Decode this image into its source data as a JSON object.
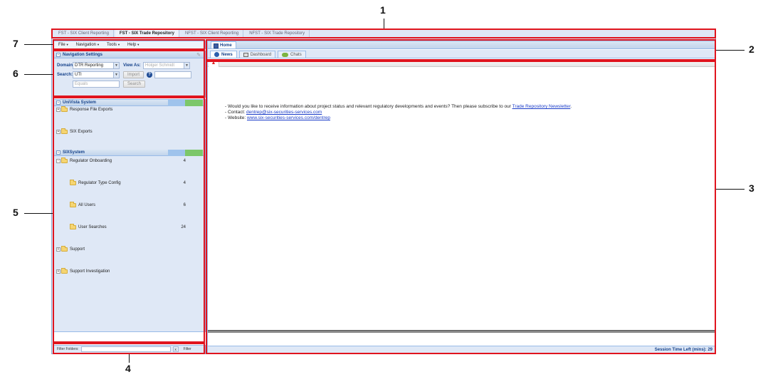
{
  "app_tabs": [
    "FST - SIX Client Reporting",
    "FST - SIX Trade Repository",
    "NFST - SIX Client Reporting",
    "NFST - SIX Trade Repository"
  ],
  "menu": [
    {
      "label": "File"
    },
    {
      "label": "Navigation"
    },
    {
      "label": "Tools"
    },
    {
      "label": "Help"
    }
  ],
  "nav_settings": {
    "title": "Navigation Settings",
    "domain_label": "Domain:",
    "domain_value": "DTR Reporting",
    "view_as_label": "View As:",
    "view_as_value": "Holger Schmidt",
    "search_label": "Search:",
    "search_field": "UTI",
    "import_label": "Import",
    "operator": "Equals",
    "search_button": "Search"
  },
  "systems": [
    {
      "title": "UniVista System",
      "items": [
        {
          "label": "Response File Exports",
          "count": ""
        },
        {
          "label": "SIX Exports",
          "count": ""
        }
      ]
    },
    {
      "title": "SIXSystem",
      "items": [
        {
          "label": "Regulator Onboarding",
          "count": "4"
        },
        {
          "label": "Regulator Type Config",
          "count": "4"
        },
        {
          "label": "All Users",
          "count": "6"
        },
        {
          "label": "User Searches",
          "count": "24"
        },
        {
          "label": "Support",
          "count": ""
        },
        {
          "label": "Support Investigation",
          "count": ""
        }
      ]
    }
  ],
  "filter": {
    "label": "Filter Folders:",
    "clear": "x",
    "button": "Filter"
  },
  "home_tab": "Home",
  "sub_tabs": [
    "News",
    "Dashboard",
    "Chats"
  ],
  "news": {
    "line1_prefix": "- Would you like to receive information about project status and relevant regulatory developments and events? Then please subscribe to our ",
    "line1_link": "Trade Repository Newsletter",
    "line1_suffix": ".",
    "contact_prefix": "- Contact: ",
    "contact_link": "dentrep@six-securities-services.com",
    "website_prefix": "- Website: ",
    "website_link": "www.six-securities-services.com/dentrep"
  },
  "session": "Session Time Left (mins): 29",
  "callouts": [
    "1",
    "2",
    "3",
    "4",
    "5",
    "6",
    "7"
  ],
  "colors": {
    "highlight": "#e0141e",
    "panel": "#dfe8f6",
    "header_text": "#15428b",
    "link": "#1a3cc8"
  }
}
